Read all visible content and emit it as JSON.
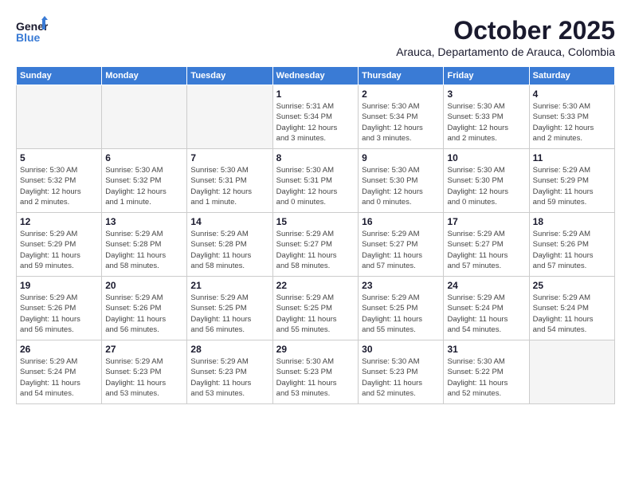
{
  "header": {
    "logo_general": "General",
    "logo_blue": "Blue",
    "month_title": "October 2025",
    "location": "Arauca, Departamento de Arauca, Colombia"
  },
  "weekdays": [
    "Sunday",
    "Monday",
    "Tuesday",
    "Wednesday",
    "Thursday",
    "Friday",
    "Saturday"
  ],
  "weeks": [
    [
      {
        "day": "",
        "info": ""
      },
      {
        "day": "",
        "info": ""
      },
      {
        "day": "",
        "info": ""
      },
      {
        "day": "1",
        "info": "Sunrise: 5:31 AM\nSunset: 5:34 PM\nDaylight: 12 hours\nand 3 minutes."
      },
      {
        "day": "2",
        "info": "Sunrise: 5:30 AM\nSunset: 5:34 PM\nDaylight: 12 hours\nand 3 minutes."
      },
      {
        "day": "3",
        "info": "Sunrise: 5:30 AM\nSunset: 5:33 PM\nDaylight: 12 hours\nand 2 minutes."
      },
      {
        "day": "4",
        "info": "Sunrise: 5:30 AM\nSunset: 5:33 PM\nDaylight: 12 hours\nand 2 minutes."
      }
    ],
    [
      {
        "day": "5",
        "info": "Sunrise: 5:30 AM\nSunset: 5:32 PM\nDaylight: 12 hours\nand 2 minutes."
      },
      {
        "day": "6",
        "info": "Sunrise: 5:30 AM\nSunset: 5:32 PM\nDaylight: 12 hours\nand 1 minute."
      },
      {
        "day": "7",
        "info": "Sunrise: 5:30 AM\nSunset: 5:31 PM\nDaylight: 12 hours\nand 1 minute."
      },
      {
        "day": "8",
        "info": "Sunrise: 5:30 AM\nSunset: 5:31 PM\nDaylight: 12 hours\nand 0 minutes."
      },
      {
        "day": "9",
        "info": "Sunrise: 5:30 AM\nSunset: 5:30 PM\nDaylight: 12 hours\nand 0 minutes."
      },
      {
        "day": "10",
        "info": "Sunrise: 5:30 AM\nSunset: 5:30 PM\nDaylight: 12 hours\nand 0 minutes."
      },
      {
        "day": "11",
        "info": "Sunrise: 5:29 AM\nSunset: 5:29 PM\nDaylight: 11 hours\nand 59 minutes."
      }
    ],
    [
      {
        "day": "12",
        "info": "Sunrise: 5:29 AM\nSunset: 5:29 PM\nDaylight: 11 hours\nand 59 minutes."
      },
      {
        "day": "13",
        "info": "Sunrise: 5:29 AM\nSunset: 5:28 PM\nDaylight: 11 hours\nand 58 minutes."
      },
      {
        "day": "14",
        "info": "Sunrise: 5:29 AM\nSunset: 5:28 PM\nDaylight: 11 hours\nand 58 minutes."
      },
      {
        "day": "15",
        "info": "Sunrise: 5:29 AM\nSunset: 5:27 PM\nDaylight: 11 hours\nand 58 minutes."
      },
      {
        "day": "16",
        "info": "Sunrise: 5:29 AM\nSunset: 5:27 PM\nDaylight: 11 hours\nand 57 minutes."
      },
      {
        "day": "17",
        "info": "Sunrise: 5:29 AM\nSunset: 5:27 PM\nDaylight: 11 hours\nand 57 minutes."
      },
      {
        "day": "18",
        "info": "Sunrise: 5:29 AM\nSunset: 5:26 PM\nDaylight: 11 hours\nand 57 minutes."
      }
    ],
    [
      {
        "day": "19",
        "info": "Sunrise: 5:29 AM\nSunset: 5:26 PM\nDaylight: 11 hours\nand 56 minutes."
      },
      {
        "day": "20",
        "info": "Sunrise: 5:29 AM\nSunset: 5:26 PM\nDaylight: 11 hours\nand 56 minutes."
      },
      {
        "day": "21",
        "info": "Sunrise: 5:29 AM\nSunset: 5:25 PM\nDaylight: 11 hours\nand 56 minutes."
      },
      {
        "day": "22",
        "info": "Sunrise: 5:29 AM\nSunset: 5:25 PM\nDaylight: 11 hours\nand 55 minutes."
      },
      {
        "day": "23",
        "info": "Sunrise: 5:29 AM\nSunset: 5:25 PM\nDaylight: 11 hours\nand 55 minutes."
      },
      {
        "day": "24",
        "info": "Sunrise: 5:29 AM\nSunset: 5:24 PM\nDaylight: 11 hours\nand 54 minutes."
      },
      {
        "day": "25",
        "info": "Sunrise: 5:29 AM\nSunset: 5:24 PM\nDaylight: 11 hours\nand 54 minutes."
      }
    ],
    [
      {
        "day": "26",
        "info": "Sunrise: 5:29 AM\nSunset: 5:24 PM\nDaylight: 11 hours\nand 54 minutes."
      },
      {
        "day": "27",
        "info": "Sunrise: 5:29 AM\nSunset: 5:23 PM\nDaylight: 11 hours\nand 53 minutes."
      },
      {
        "day": "28",
        "info": "Sunrise: 5:29 AM\nSunset: 5:23 PM\nDaylight: 11 hours\nand 53 minutes."
      },
      {
        "day": "29",
        "info": "Sunrise: 5:30 AM\nSunset: 5:23 PM\nDaylight: 11 hours\nand 53 minutes."
      },
      {
        "day": "30",
        "info": "Sunrise: 5:30 AM\nSunset: 5:23 PM\nDaylight: 11 hours\nand 52 minutes."
      },
      {
        "day": "31",
        "info": "Sunrise: 5:30 AM\nSunset: 5:22 PM\nDaylight: 11 hours\nand 52 minutes."
      },
      {
        "day": "",
        "info": ""
      }
    ]
  ]
}
